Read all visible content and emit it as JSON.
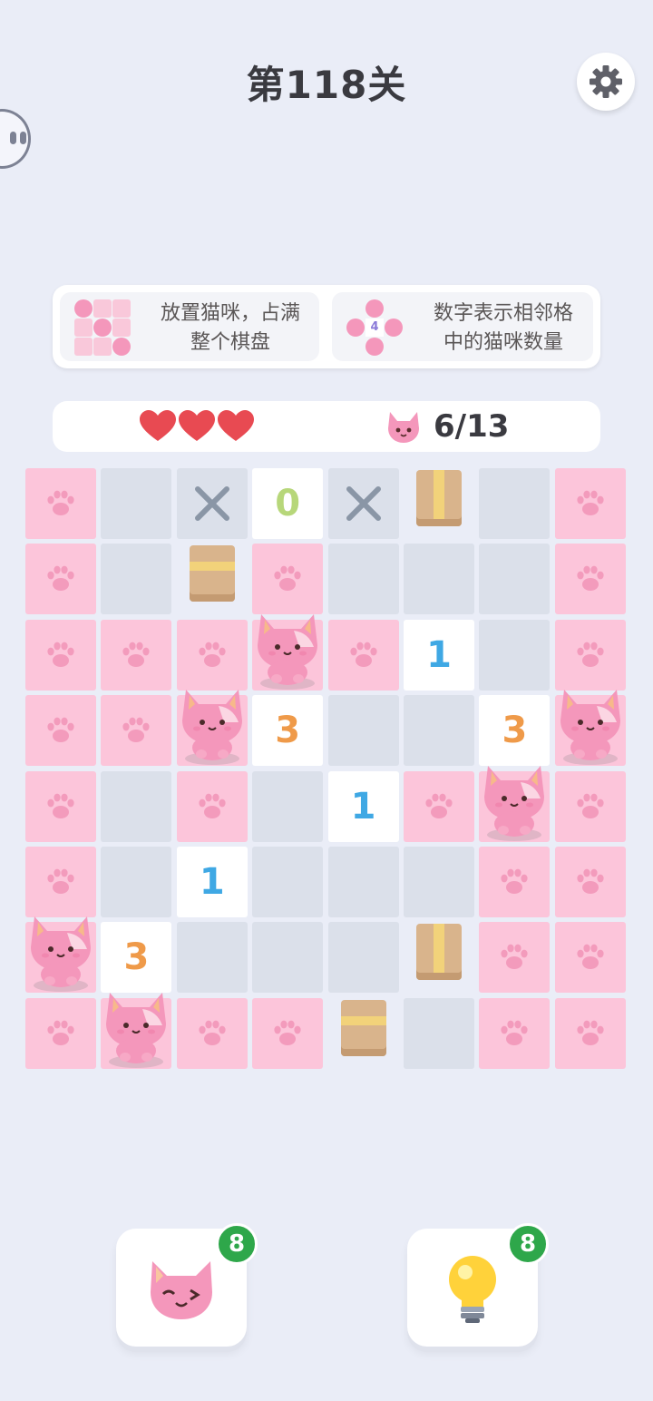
{
  "header": {
    "title": "第118关"
  },
  "rules": [
    {
      "text_line1": "放置猫咪，占满",
      "text_line2": "整个棋盘"
    },
    {
      "text_line1": "数字表示相邻格",
      "text_line2": "中的猫咪数量",
      "example_number": "4"
    }
  ],
  "status": {
    "lives": 3,
    "cats_placed": "6/13"
  },
  "board": {
    "size": 8,
    "legend": {
      "P": "paw-marked",
      "E": "empty",
      "X": "blocked-x",
      "B": "box-vertical-tape",
      "H": "box-horizontal-tape",
      "C": "cat",
      "N": "number-clue"
    },
    "rows": [
      [
        "P",
        "E",
        "X",
        "N0",
        "X",
        "B",
        "E",
        "P"
      ],
      [
        "P",
        "E",
        "H",
        "P",
        "E",
        "E",
        "E",
        "P"
      ],
      [
        "P",
        "P",
        "P",
        "C",
        "P",
        "N1",
        "E",
        "P"
      ],
      [
        "P",
        "P",
        "C",
        "N3",
        "E",
        "E",
        "N3",
        "C"
      ],
      [
        "P",
        "E",
        "P",
        "E",
        "N1",
        "P",
        "C",
        "P"
      ],
      [
        "P",
        "E",
        "N1",
        "E",
        "E",
        "E",
        "P",
        "P"
      ],
      [
        "C",
        "N3",
        "E",
        "E",
        "E",
        "B",
        "P",
        "P"
      ],
      [
        "P",
        "C",
        "P",
        "P",
        "H",
        "E",
        "P",
        "P"
      ]
    ]
  },
  "tools": {
    "cat_hint": {
      "count": "8",
      "icon": "winking-cat-icon"
    },
    "bulb_hint": {
      "count": "8",
      "icon": "lightbulb-icon"
    }
  },
  "colors": {
    "paw_cell": "#fcc5da",
    "empty_cell": "#dbe0ea",
    "badge": "#2ea74a",
    "clue_blue": "#3fa8e4",
    "clue_orange": "#ef9a49",
    "clue_green": "#b7d77a"
  }
}
